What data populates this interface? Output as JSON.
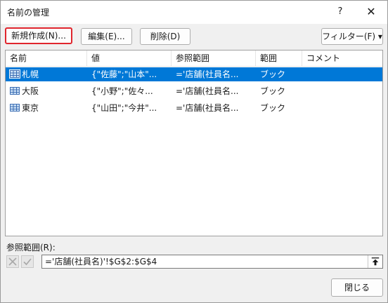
{
  "window": {
    "title": "名前の管理",
    "help_label": "?",
    "close_label": "✕"
  },
  "toolbar": {
    "new_label": "新規作成(N)...",
    "edit_label": "編集(E)...",
    "delete_label": "削除(D)",
    "filter_label": "フィルター(F) ▾"
  },
  "columns": [
    "名前",
    "値",
    "参照範囲",
    "範囲",
    "コメント"
  ],
  "rows": [
    {
      "name": "札幌",
      "value": "{\"佐藤\";\"山本\"...",
      "refers_to": "='店舗(社員名...",
      "scope": "ブック",
      "comment": "",
      "selected": true
    },
    {
      "name": "大阪",
      "value": "{\"小野\";\"佐々...",
      "refers_to": "='店舗(社員名...",
      "scope": "ブック",
      "comment": "",
      "selected": false
    },
    {
      "name": "東京",
      "value": "{\"山田\";\"今井\"...",
      "refers_to": "='店舗(社員名...",
      "scope": "ブック",
      "comment": "",
      "selected": false
    }
  ],
  "reference": {
    "label": "参照範囲(R):",
    "value": "='店舗(社員名)'!$G$2:$G$4"
  },
  "footer": {
    "close_label": "閉じる"
  },
  "icons": {
    "row_icon": "name-grid-icon",
    "cancel": "cancel-x-icon",
    "confirm": "checkmark-icon",
    "collapse": "collapse-dialog-icon"
  },
  "colors": {
    "selection": "#0078d7",
    "highlight_border": "#e0262e",
    "icon_blue": "#3b6db3"
  }
}
